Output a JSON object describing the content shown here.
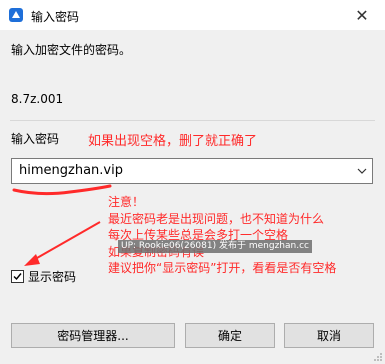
{
  "window": {
    "title": "输入密码",
    "close_symbol": "✕"
  },
  "dialog": {
    "prompt": "输入加密文件的密码。",
    "filename": "8.7z.001",
    "password_label": "输入密码",
    "password_value": "himengzhan.vip",
    "show_password_label": "显示密码",
    "show_password_checked": true,
    "buttons": {
      "manager": "密码管理器...",
      "ok": "确定",
      "cancel": "取消"
    }
  },
  "annotations": {
    "top_note": "如果出现空格，删了就正确了",
    "lines": [
      "注意！",
      "最近密码老是出现问题，也不知道为什么",
      "每次上传某些总是会多打一个空格",
      "如果复制密码有误",
      "建议把你“显示密码”打开，看看是否有空格"
    ],
    "watermark": "UP: Rookie06(26081) 发布于 mengzhan.cc",
    "color": "#ff2a2a"
  },
  "icons": {
    "app": "app-icon",
    "close": "close-icon",
    "dropdown": "chevron-down-icon",
    "checkmark": "checkmark-icon",
    "grip": "resize-grip-icon"
  }
}
